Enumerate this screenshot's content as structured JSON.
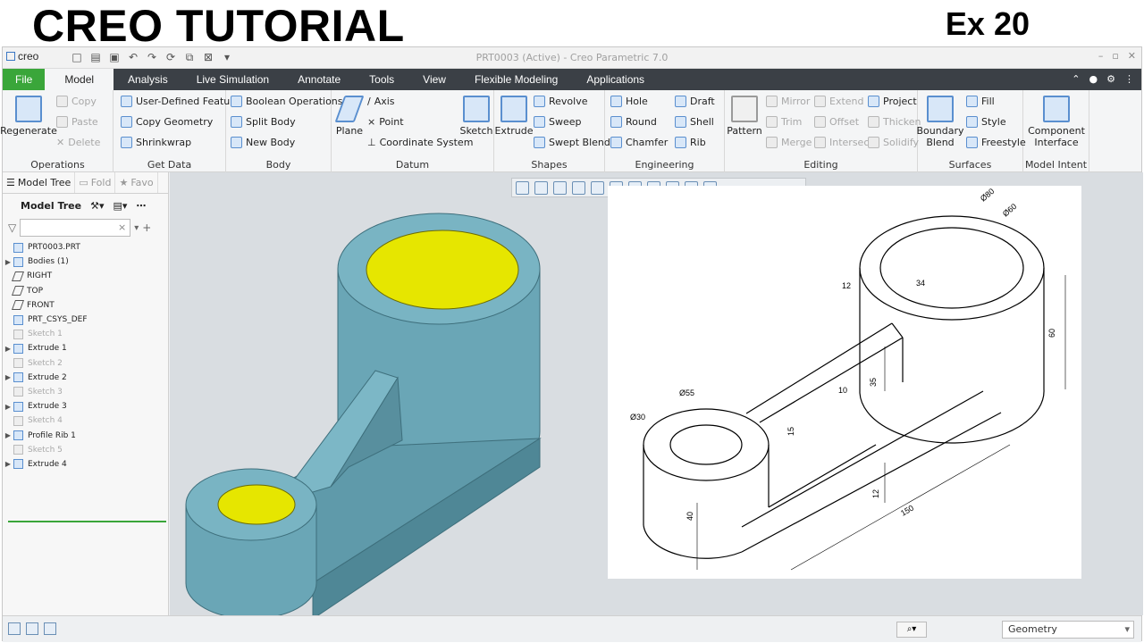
{
  "banner": {
    "title": "CREO TUTORIAL",
    "exercise": "Ex 20"
  },
  "app": {
    "logo": "creo",
    "window_title": "PRT0003 (Active) - Creo Parametric 7.0"
  },
  "tabs": [
    "File",
    "Model",
    "Analysis",
    "Live Simulation",
    "Annotate",
    "Tools",
    "View",
    "Flexible Modeling",
    "Applications"
  ],
  "ribbon": {
    "operations": {
      "label": "Operations",
      "regenerate": "Regenerate",
      "copy": "Copy",
      "paste": "Paste",
      "delete": "Delete"
    },
    "get_data": {
      "label": "Get Data",
      "udf": "User-Defined Feature",
      "copy_geometry": "Copy Geometry",
      "shrinkwrap": "Shrinkwrap"
    },
    "body": {
      "label": "Body",
      "boolean": "Boolean Operations",
      "split": "Split Body",
      "new": "New Body"
    },
    "datum": {
      "label": "Datum",
      "plane": "Plane",
      "axis": "Axis",
      "point": "Point",
      "csys": "Coordinate System",
      "sketch": "Sketch"
    },
    "shapes": {
      "label": "Shapes",
      "extrude": "Extrude",
      "revolve": "Revolve",
      "sweep": "Sweep",
      "swept_blend": "Swept Blend"
    },
    "engineering": {
      "label": "Engineering",
      "hole": "Hole",
      "round": "Round",
      "chamfer": "Chamfer",
      "draft": "Draft",
      "shell": "Shell",
      "rib": "Rib"
    },
    "editing": {
      "label": "Editing",
      "pattern": "Pattern",
      "mirror": "Mirror",
      "trim": "Trim",
      "merge": "Merge",
      "extend": "Extend",
      "offset": "Offset",
      "intersect": "Intersect",
      "project": "Project",
      "thicken": "Thicken",
      "solidify": "Solidify"
    },
    "surfaces": {
      "label": "Surfaces",
      "boundary": "Boundary",
      "blend": "Blend",
      "fill": "Fill",
      "style": "Style",
      "freestyle": "Freestyle"
    },
    "model_intent": {
      "label": "Model Intent",
      "component": "Component",
      "interface": "Interface"
    }
  },
  "panel": {
    "tab_model_tree": "Model Tree",
    "tab_folder": "Fold",
    "tab_favorites": "Favo",
    "header": "Model Tree",
    "tree": [
      {
        "label": "PRT0003.PRT",
        "expand": "",
        "dim": false
      },
      {
        "label": "Bodies (1)",
        "expand": "▶",
        "dim": false
      },
      {
        "label": "RIGHT",
        "expand": "",
        "dim": false
      },
      {
        "label": "TOP",
        "expand": "",
        "dim": false
      },
      {
        "label": "FRONT",
        "expand": "",
        "dim": false
      },
      {
        "label": "PRT_CSYS_DEF",
        "expand": "",
        "dim": false
      },
      {
        "label": "Sketch 1",
        "expand": "",
        "dim": true
      },
      {
        "label": "Extrude 1",
        "expand": "▶",
        "dim": false
      },
      {
        "label": "Sketch 2",
        "expand": "",
        "dim": true
      },
      {
        "label": "Extrude 2",
        "expand": "▶",
        "dim": false
      },
      {
        "label": "Sketch 3",
        "expand": "",
        "dim": true
      },
      {
        "label": "Extrude 3",
        "expand": "▶",
        "dim": false
      },
      {
        "label": "Sketch 4",
        "expand": "",
        "dim": true
      },
      {
        "label": "Profile Rib 1",
        "expand": "▶",
        "dim": false
      },
      {
        "label": "Sketch 5",
        "expand": "",
        "dim": true
      },
      {
        "label": "Extrude 4",
        "expand": "▶",
        "dim": false
      }
    ]
  },
  "drawing": {
    "dims": [
      "Ø80",
      "Ø60",
      "12",
      "34",
      "60",
      "35",
      "10",
      "15",
      "Ø55",
      "Ø30",
      "40",
      "12",
      "150"
    ]
  },
  "status": {
    "selection_filter": "Geometry"
  },
  "colors": {
    "model_body": "#6aa6b6",
    "model_face": "#e6e600",
    "file_tab": "#3aa63a",
    "tab_bar": "#3b4046"
  }
}
